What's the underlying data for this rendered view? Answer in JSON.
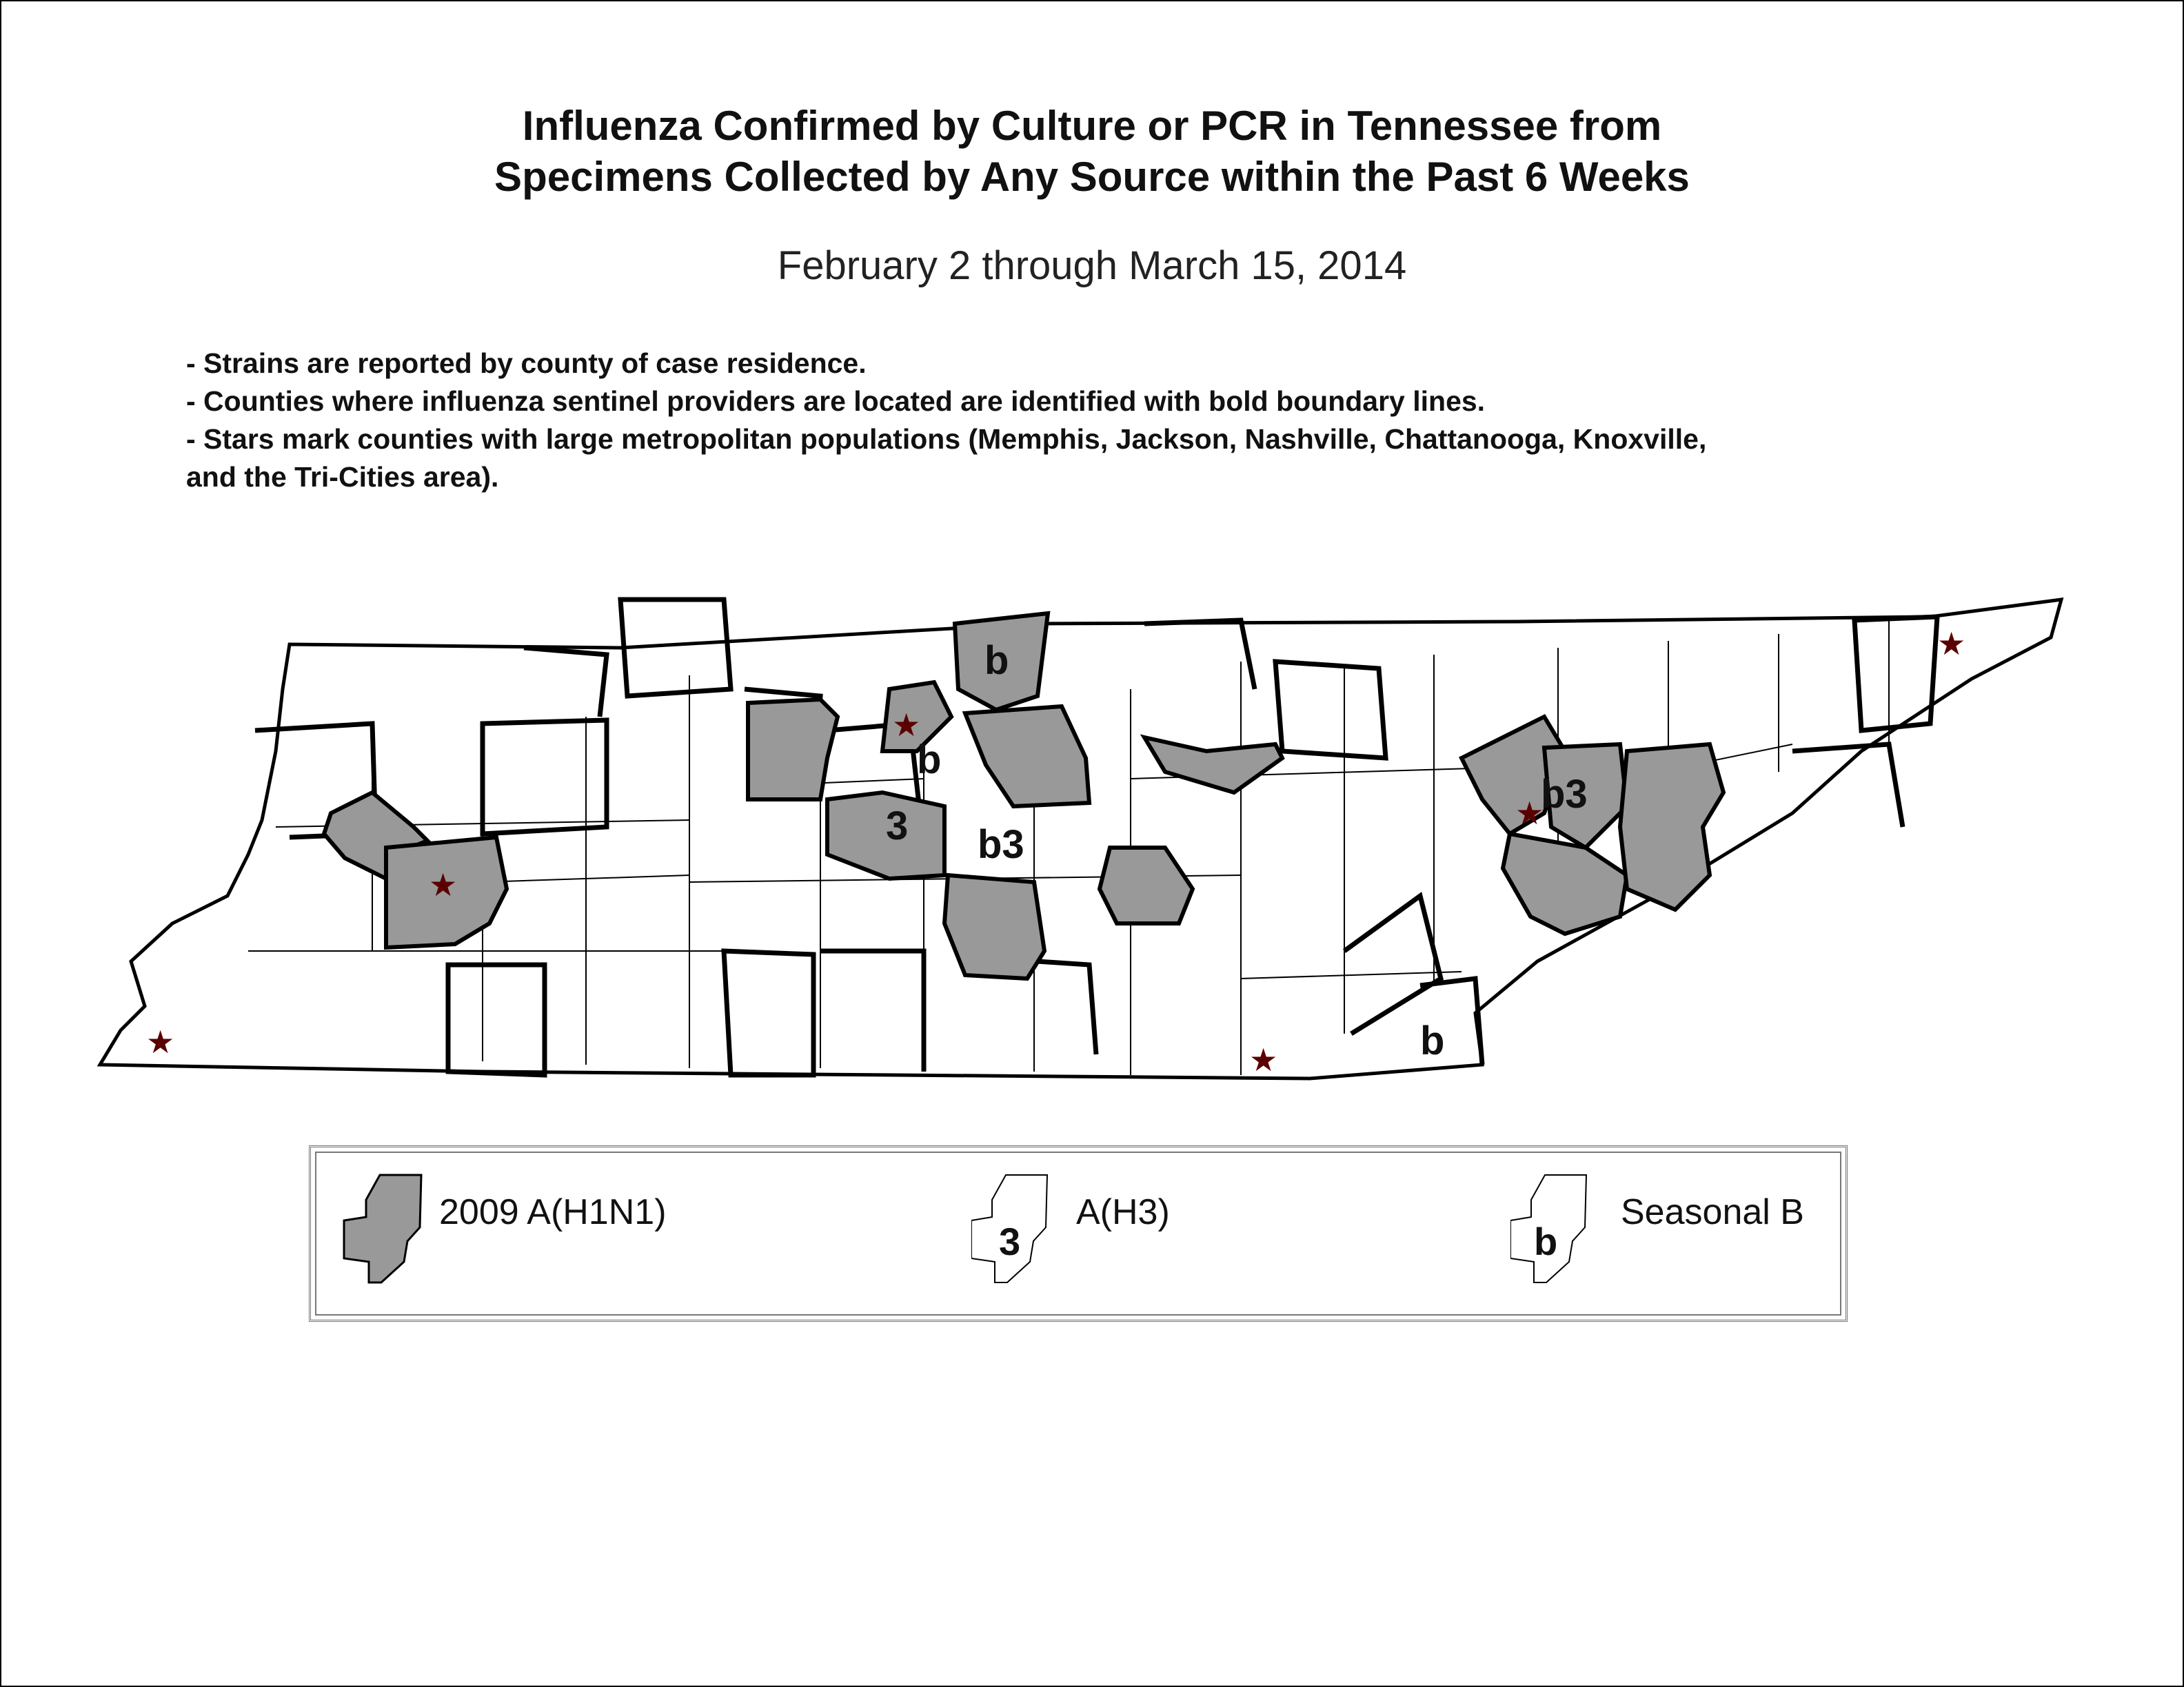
{
  "title": {
    "line1": "Influenza Confirmed by Culture or PCR in Tennessee from",
    "line2": "Specimens Collected by Any Source within the Past 6 Weeks"
  },
  "date_range": "February 2 through March 15, 2014",
  "notes": [
    "- Strains are reported by county of case residence.",
    "- Counties where influenza sentinel providers are located are identified with bold boundary lines.",
    "- Stars mark counties with large metropolitan populations (Memphis, Jackson, Nashville, Chattanooga, Knoxville,",
    "and the Tri-Cities area)."
  ],
  "map": {
    "state": "Tennessee",
    "fill_colors": {
      "h1n1": "#999999",
      "none": "#ffffff",
      "star": "#5a0000"
    },
    "strain_labels": [
      "b",
      "b",
      "3",
      "b3",
      "b3",
      "b"
    ],
    "star_symbol": "★"
  },
  "legend": {
    "items": [
      {
        "label": "2009 A(H1N1)",
        "symbol": "gray-filled-county"
      },
      {
        "label": "A(H3)",
        "symbol_text": "3"
      },
      {
        "label": "Seasonal B",
        "symbol_text": "b"
      }
    ]
  }
}
